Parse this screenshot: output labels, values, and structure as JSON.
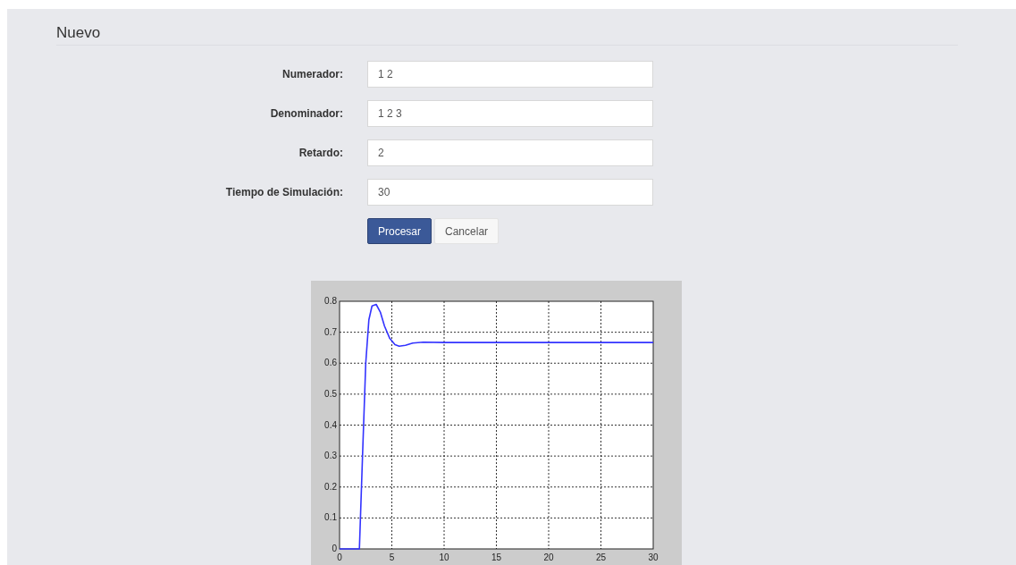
{
  "title": "Nuevo",
  "fields": [
    {
      "label": "Numerador:",
      "value": "1 2"
    },
    {
      "label": "Denominador:",
      "value": "1 2 3"
    },
    {
      "label": "Retardo:",
      "value": "2"
    },
    {
      "label": "Tiempo de Simulación:",
      "value": "30"
    }
  ],
  "buttons": [
    {
      "label": "Procesar",
      "kind": "primary"
    },
    {
      "label": "Cancelar",
      "kind": "default"
    }
  ],
  "chart_data": {
    "type": "line",
    "x": [
      0,
      1,
      1.9,
      2.2,
      2.5,
      2.8,
      3.1,
      3.5,
      3.9,
      4.3,
      4.8,
      5.3,
      5.7,
      6.3,
      7,
      8,
      10,
      15,
      20,
      25,
      30
    ],
    "grid": true,
    "series": [
      {
        "color": "#3333ff",
        "values": [
          0,
          0,
          0,
          0.3,
          0.6,
          0.74,
          0.785,
          0.79,
          0.765,
          0.72,
          0.68,
          0.66,
          0.655,
          0.658,
          0.665,
          0.668,
          0.667,
          0.667,
          0.667,
          0.667,
          0.667
        ]
      }
    ],
    "xlim": [
      0,
      30
    ],
    "ylim": [
      0,
      0.8
    ],
    "xticks": [
      0,
      5,
      10,
      15,
      20,
      25,
      30
    ],
    "yticks": [
      0,
      0.1,
      0.2,
      0.3,
      0.4,
      0.5,
      0.6,
      0.7,
      0.8
    ]
  }
}
